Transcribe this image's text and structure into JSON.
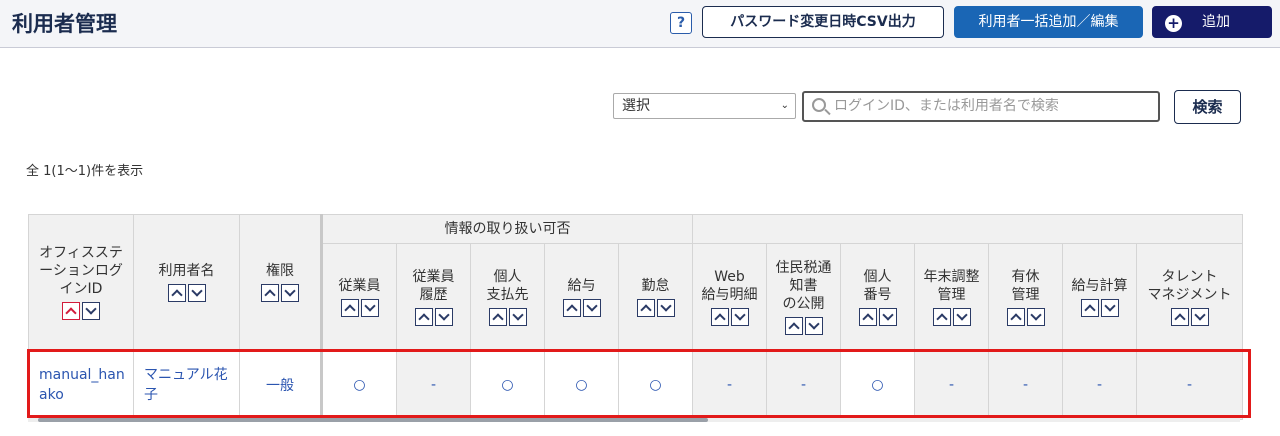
{
  "page": {
    "title": "利用者管理"
  },
  "header": {
    "help_label": "?",
    "csv_label": "パスワード変更日時CSV出力",
    "bulk_label": "利用者一括追加／編集",
    "add_label": "追加",
    "add_icon": "+"
  },
  "filter": {
    "select_value": "選択",
    "search_placeholder": "ログインID、または利用者名で検索",
    "search_button": "検索"
  },
  "result_count": "全 1(1～1)件を表示",
  "table": {
    "group_header": "情報の取り扱い可否",
    "col_login": "オフィスステーションログインID",
    "col_name": "利用者名",
    "col_role": "権限",
    "perm_headers": [
      "従業員",
      "従業員\n履歴",
      "個人\n支払先",
      "給与",
      "勤怠",
      "Web\n給与明細",
      "住民税通\n知書\nの公開",
      "個人\n番号",
      "年末調整\n管理",
      "有休\n管理",
      "給与計算",
      "タレント\nマネジメント"
    ],
    "row": {
      "login_id": "manual_hanako",
      "name": "マニュアル花子",
      "role": "一般",
      "perms": [
        "○",
        "-",
        "○",
        "○",
        "○",
        "-",
        "-",
        "○",
        "-",
        "-",
        "-",
        "-"
      ]
    }
  }
}
